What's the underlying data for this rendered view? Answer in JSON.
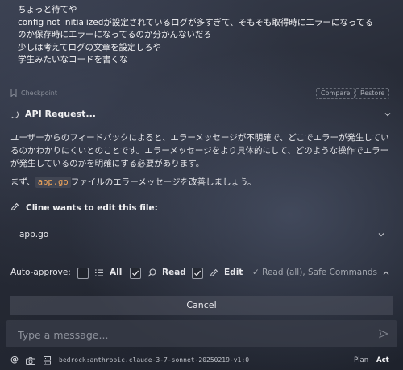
{
  "user_message": "ちょっと待てや\nconfig not initializedが設定されているログが多すぎて、そもそも取得時にエラーになってる\nのか保存時にエラーになってるのか分かんないだろ\n少しは考えてログの文章を設定しろや\n学生みたいなコードを書くな",
  "checkpoint": {
    "label": "Checkpoint",
    "compare": "Compare",
    "restore": "Restore"
  },
  "api_request": {
    "label": "API Request..."
  },
  "response": {
    "para1": "ユーザーからのフィードバックによると、エラーメッセージが不明確で、どこでエラーが発生しているのかわかりにくいとのことです。エラーメッセージをより具体的にして、どのような操作でエラーが発生しているのかを明確にする必要があります。",
    "para2_prefix": "まず、",
    "para2_code": "app.go",
    "para2_suffix": "ファイルのエラーメッセージを改善しましょう。"
  },
  "edit": {
    "header": "Cline wants to edit this file:",
    "filename": "app.go"
  },
  "auto_approve": {
    "label": "Auto-approve:",
    "all": "All",
    "read": "Read",
    "edit": "Edit",
    "summary": "✓ Read (all), Safe Commands",
    "all_checked": false,
    "read_checked": true,
    "edit_checked": true
  },
  "cancel_label": "Cancel",
  "input": {
    "placeholder": "Type a message..."
  },
  "footer": {
    "at": "@",
    "model": "bedrock:anthropic.claude-3-7-sonnet-20250219-v1:0",
    "plan": "Plan",
    "act": "Act"
  },
  "colors": {
    "code_accent": "#f0a55a",
    "background": "#262a35"
  }
}
